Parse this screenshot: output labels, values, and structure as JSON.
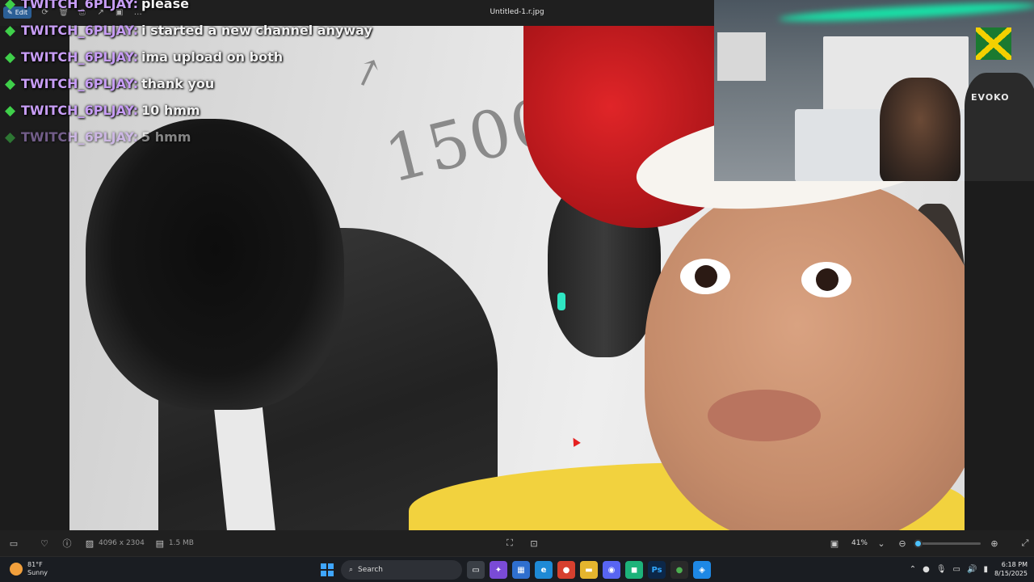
{
  "viewer": {
    "file_title": "Untitled-1.r.jpg",
    "edit_label": "Edit",
    "dimensions": "4096 x 2304",
    "file_size": "1.5 MB",
    "zoom_label": "41%",
    "zoom_level": 0.05
  },
  "chat": {
    "messages": [
      {
        "user": "TWITCH_6PLJAY:",
        "text": "please"
      },
      {
        "user": "TWITCH_6PLJAY:",
        "text": "i started a new channel anyway"
      },
      {
        "user": "TWITCH_6PLJAY:",
        "text": "ima upload on both"
      },
      {
        "user": "TWITCH_6PLJAY:",
        "text": "thank you"
      },
      {
        "user": "TWITCH_6PLJAY:",
        "text": "10 hmm"
      },
      {
        "user": "TWITCH_6PLJAY:",
        "text": "5 hmm"
      }
    ]
  },
  "photo": {
    "scribble_number": "1500",
    "chair_brand": "EVOKO"
  },
  "taskbar": {
    "weather_temp": "81°F",
    "weather_desc": "Sunny",
    "search_label": "Search",
    "time": "6:18 PM",
    "date": "8/15/2025",
    "ps_label": "Ps"
  },
  "colors": {
    "accent": "#4cc2ff",
    "chat_user": "#c79df5",
    "badge": "#3fd04a"
  }
}
